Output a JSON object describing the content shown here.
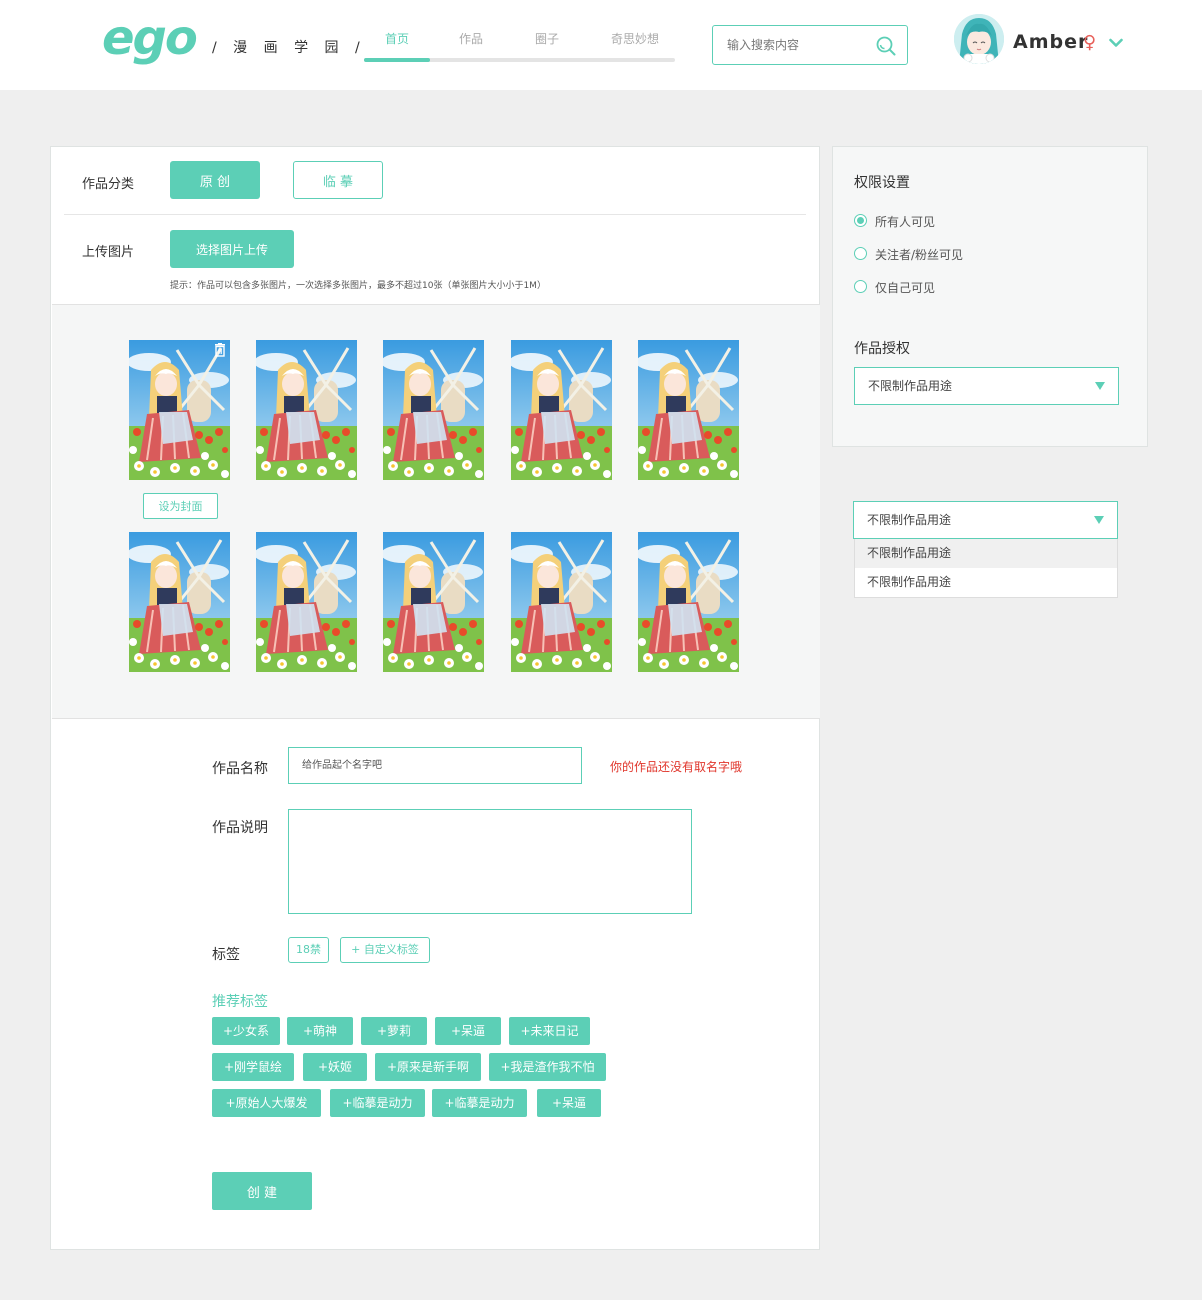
{
  "header": {
    "logo": "ego",
    "slogan": "/ 漫 画 学 园 /",
    "nav": [
      {
        "label": "首页",
        "active": true
      },
      {
        "label": "作品",
        "active": false
      },
      {
        "label": "圈子",
        "active": false
      },
      {
        "label": "奇思妙想",
        "active": false
      }
    ],
    "search_placeholder": "输入搜索内容",
    "username": "Amber",
    "gender_symbol": "♀"
  },
  "form": {
    "category_label": "作品分类",
    "category_options": [
      "原 创",
      "临 摹"
    ],
    "category_selected": "原 创",
    "upload_label": "上传图片",
    "upload_button": "选择图片上传",
    "upload_hint": "提示：作品可以包含多张图片，一次选择多张图片，最多不超过10张（单张图片大小小于1M）",
    "images_count": 10,
    "set_cover_button": "设为封面",
    "name_label": "作品名称",
    "name_placeholder": "给作品起个名字吧",
    "name_error": "你的作品还没有取名字哦",
    "desc_label": "作品说明",
    "tags_label": "标签",
    "tags": [
      "18禁"
    ],
    "custom_tag_button": "+ 自定义标签",
    "recommended_title": "推荐标签",
    "recommended_tags": [
      [
        "+少女系",
        "+萌神",
        "+萝莉",
        "+呆逼",
        "+未来日记"
      ],
      [
        "+刚学鼠绘",
        "+妖姬",
        "+原来是新手啊",
        "+我是渣作我不怕"
      ],
      [
        "+原始人大爆发",
        "+临摹是动力",
        "+临摹是动力",
        "+呆逼"
      ]
    ],
    "submit_button": "创 建"
  },
  "sidebar": {
    "permission_title": "权限设置",
    "permission_options": [
      "所有人可见",
      "关注者/粉丝可见",
      "仅自己可见"
    ],
    "permission_selected": 0,
    "license_title": "作品授权",
    "license_value": "不限制作品用途"
  },
  "dropdown_demo": {
    "value": "不限制作品用途",
    "options": [
      "不限制作品用途",
      "不限制作品用途"
    ],
    "highlighted": 0
  },
  "colors": {
    "accent": "#5ccfb6",
    "error": "#e0352b",
    "gender": "#e8605a"
  }
}
